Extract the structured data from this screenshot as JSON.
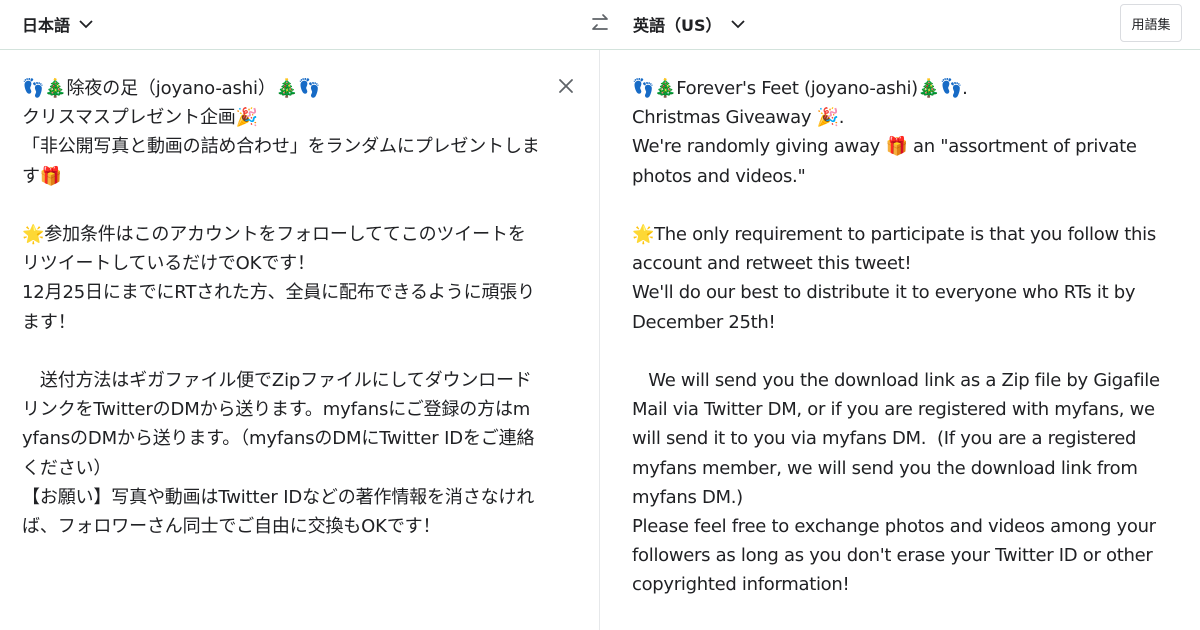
{
  "header": {
    "source_language": "日本語",
    "target_language": "英語（US）",
    "glossary_label": "用語集"
  },
  "source": {
    "text": "👣🎄除夜の足（joyano-ashi）🎄👣\nクリスマスプレゼント企画🎉\n「非公開写真と動画の詰め合わせ」をランダムにプレゼントします🎁\n\n🌟参加条件はこのアカウントをフォローしててこのツイートをリツイートしているだけでOKです！\n12月25日にまでにRTされた方、全員に配布できるように頑張ります！\n\n　送付方法はギガファイル便でZipファイルにしてダウンロードリンクをTwitterのDMから送ります。myfansにご登録の方はmyfansのDMから送ります。（myfansのDMにTwitter IDをご連絡ください）\n【お願い】写真や動画はTwitter IDなどの著作情報を消さなければ、フォロワーさん同士でご自由に交換もOKです！"
  },
  "target": {
    "text": "👣🎄Forever's Feet (joyano-ashi)🎄👣.\nChristmas Giveaway 🎉.\nWe're randomly giving away 🎁 an \"assortment of private photos and videos.\"\n\n🌟The only requirement to participate is that you follow this account and retweet this tweet!\nWe'll do our best to distribute it to everyone who RTs it by December 25th!\n\n   We will send you the download link as a Zip file by Gigafile Mail via Twitter DM, or if you are registered with myfans, we will send it to you via myfans DM.  (If you are a registered myfans member, we will send you the download link from myfans DM.)\nPlease feel free to exchange photos and videos among your followers as long as you don't erase your Twitter ID or other copyrighted information!"
  },
  "icons": {
    "source_lang_chevron": "chevron-down-icon",
    "target_lang_chevron": "chevron-down-icon",
    "swap": "swap-languages-icon",
    "clear": "close-icon"
  }
}
